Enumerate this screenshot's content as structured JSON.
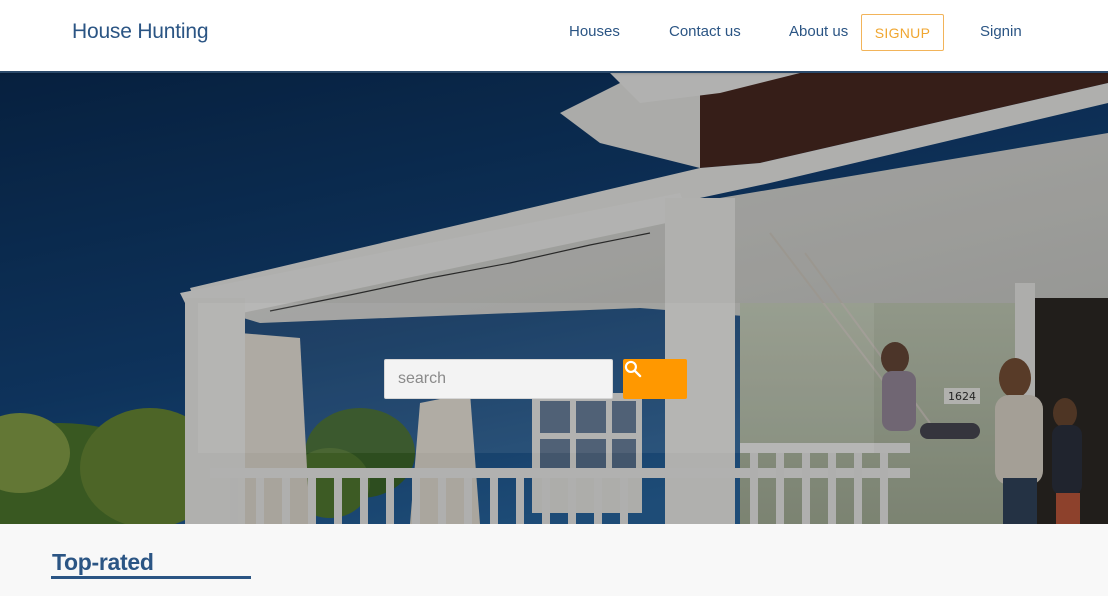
{
  "header": {
    "brand": "House Hunting",
    "nav": {
      "houses": "Houses",
      "contact": "Contact us",
      "about": "About us",
      "signup": "SIGNUP",
      "signin": "Signin"
    }
  },
  "hero": {
    "search": {
      "placeholder": "search",
      "value": ""
    },
    "search_icon": "search-icon",
    "house_number": "1624"
  },
  "section": {
    "title": "Top-rated"
  },
  "colors": {
    "brand": "#2b5584",
    "accent": "#ff9800",
    "signup_border": "#f2b45a",
    "page_bg": "#f8f8f8"
  }
}
